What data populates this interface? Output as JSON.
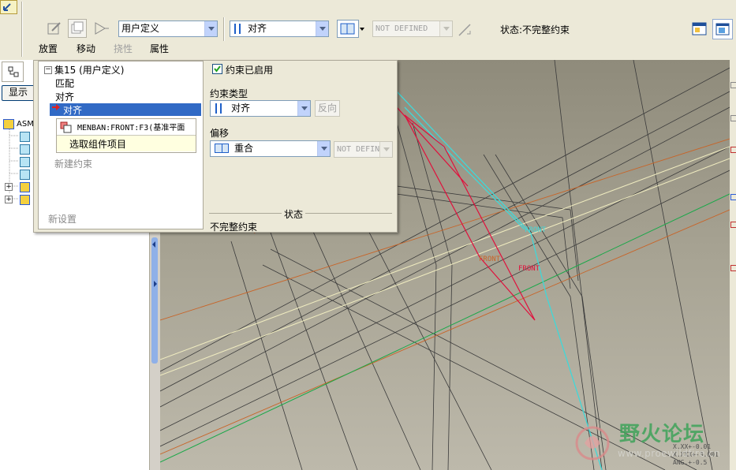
{
  "toolbar": {
    "component_type": "用户定义",
    "constraint_type": "对齐",
    "offset_value": "NOT DEFINED",
    "status": "状态:不完整约束"
  },
  "tabs": [
    "放置",
    "移动",
    "挠性",
    "属性"
  ],
  "placement": {
    "set_label": "集15 (用户定义)",
    "items": [
      "匹配",
      "对齐"
    ],
    "selected_item": "对齐",
    "reference": "MENBAN:FRONT:F3(基准平面",
    "pick_prompt": "选取组件项目",
    "new_constraint": "新建约束",
    "new_set": "新设置",
    "enabled_label": "约束已启用",
    "constraint_type_label": "约束类型",
    "constraint_type_value": "对齐",
    "flip_label": "反向",
    "offset_label": "偏移",
    "offset_type_value": "重合",
    "offset_value": "NOT DEFIN",
    "status_header": "状态",
    "status_value": "不完整约束"
  },
  "tree": {
    "show_button": "显示",
    "root_label": "ASM"
  },
  "viewport": {
    "datum_labels": [
      "FRONT",
      "FRONT",
      "FRONT"
    ],
    "tolerance_lines": [
      "X.XX+-0.01",
      "X.XXX+-0.001",
      "ANG.+-0.5"
    ]
  },
  "watermark": {
    "title": "野火论坛",
    "url": "www.proewildfire.cn"
  },
  "colors": {
    "toolbar_bg": "#ece9d8",
    "selection": "#316ac5",
    "viewport_bg": "#9f9b8b",
    "datum_red": "#e0103c",
    "datum_cyan": "#40d8d8",
    "datum_orange": "#c86428",
    "accent_green": "#18a848"
  }
}
